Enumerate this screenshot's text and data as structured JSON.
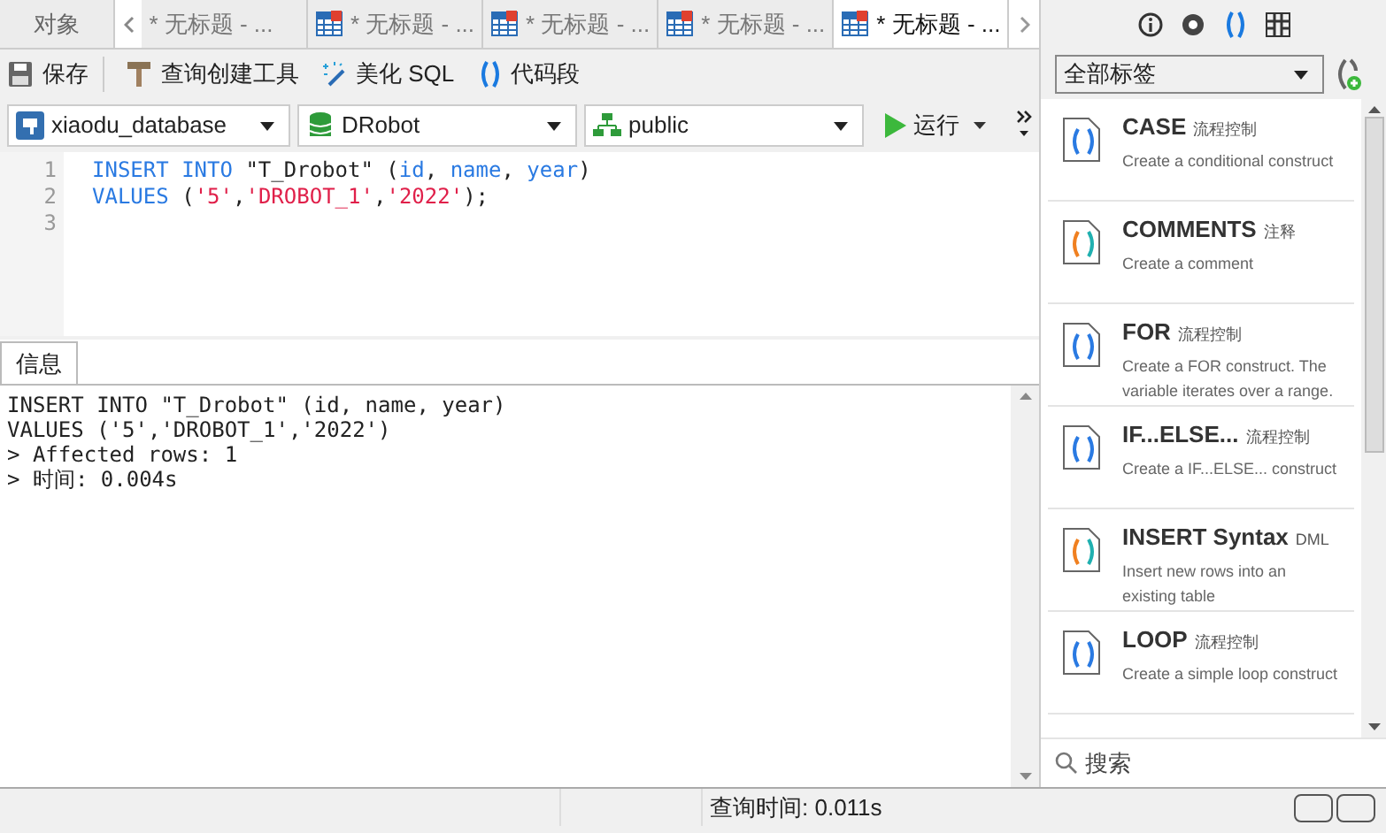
{
  "tabs": [
    {
      "label": "对象",
      "kind": "objects",
      "selected": false
    },
    {
      "label": "* 无标题 - ...",
      "kind": "query",
      "selected": false,
      "icon": false
    },
    {
      "label": "* 无标题 - ...",
      "kind": "query",
      "selected": false,
      "icon": true
    },
    {
      "label": "* 无标题 - ...",
      "kind": "query",
      "selected": false,
      "icon": true
    },
    {
      "label": "* 无标题 - ...",
      "kind": "query",
      "selected": false,
      "icon": true
    },
    {
      "label": "* 无标题 - ...",
      "kind": "query",
      "selected": true,
      "icon": true
    }
  ],
  "toolbar": [
    {
      "label": "保存"
    },
    {
      "label": "查询创建工具"
    },
    {
      "label": "美化 SQL"
    },
    {
      "label": "代码段"
    }
  ],
  "selectors": [
    {
      "value": "xiaodu_database"
    },
    {
      "value": "DRobot"
    },
    {
      "value": "public"
    }
  ],
  "run_button": {
    "label": "运行"
  },
  "editor": {
    "lines": [
      {
        "number": "1",
        "tokens": [
          {
            "text": "INSERT INTO ",
            "kind": "keyword"
          },
          {
            "text": "\"T_Drobot\" (",
            "kind": "plain"
          },
          {
            "text": "id",
            "kind": "keyword"
          },
          {
            "text": ", ",
            "kind": "plain"
          },
          {
            "text": "name",
            "kind": "keyword"
          },
          {
            "text": ", ",
            "kind": "plain"
          },
          {
            "text": "year",
            "kind": "keyword"
          },
          {
            "text": ")",
            "kind": "plain"
          }
        ]
      },
      {
        "number": "2",
        "tokens": [
          {
            "text": "VALUES ",
            "kind": "keyword"
          },
          {
            "text": "(",
            "kind": "plain"
          },
          {
            "text": "'5'",
            "kind": "string"
          },
          {
            "text": ",",
            "kind": "plain"
          },
          {
            "text": "'DROBOT_1'",
            "kind": "string"
          },
          {
            "text": ",",
            "kind": "plain"
          },
          {
            "text": "'2022'",
            "kind": "string"
          },
          {
            "text": ");",
            "kind": "plain"
          }
        ]
      },
      {
        "number": "3"
      }
    ]
  },
  "result_tabs": [
    {
      "label": "信息",
      "selected": true
    }
  ],
  "messages": [
    "INSERT INTO \"T_Drobot\" (id, name, year)",
    "VALUES ('5','DROBOT_1','2022')",
    "> Affected rows: 1",
    "> 时间: 0.004s"
  ],
  "side_panel": {
    "filter": {
      "value": "全部标签"
    },
    "snippets": [
      {
        "title": "CASE",
        "tag": "流程控制",
        "description": "Create a conditional construct",
        "kind": "plain"
      },
      {
        "title": "COMMENTS",
        "tag": "注释",
        "description": "Create a comment",
        "kind": "multi"
      },
      {
        "title": "FOR",
        "tag": "流程控制",
        "description": "Create a FOR construct. The variable iterates over a range.",
        "kind": "plain"
      },
      {
        "title": "IF...ELSE...",
        "tag": "流程控制",
        "description": "Create a IF...ELSE... construct",
        "kind": "plain"
      },
      {
        "title": "INSERT Syntax",
        "tag": "DML",
        "description": "Insert new rows into an existing table",
        "kind": "multi"
      },
      {
        "title": "LOOP",
        "tag": "流程控制",
        "description": "Create a simple loop construct",
        "kind": "plain"
      }
    ],
    "search": {
      "placeholder": "搜索"
    }
  },
  "status_bar": {
    "query_time": "查询时间: 0.011s"
  }
}
